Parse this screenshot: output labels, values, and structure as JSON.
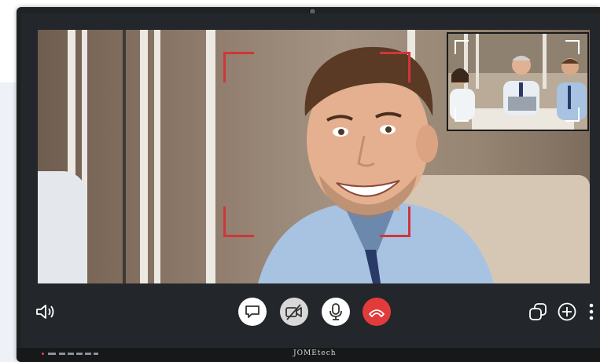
{
  "device": {
    "brand_text": "JOMEtech"
  },
  "call": {
    "colors": {
      "focus_frame": "#d0353a",
      "hangup": "#e23b3b",
      "screen_background": "#23272b"
    }
  },
  "controls": {
    "speaker": "speaker-icon",
    "chat": "chat-bubble-icon",
    "camera_off": "camera-off-icon",
    "microphone": "microphone-icon",
    "end_call": "phone-hangup-icon",
    "switch_window": "switch-window-icon",
    "add": "add-icon",
    "more": "more-vertical-icon"
  }
}
